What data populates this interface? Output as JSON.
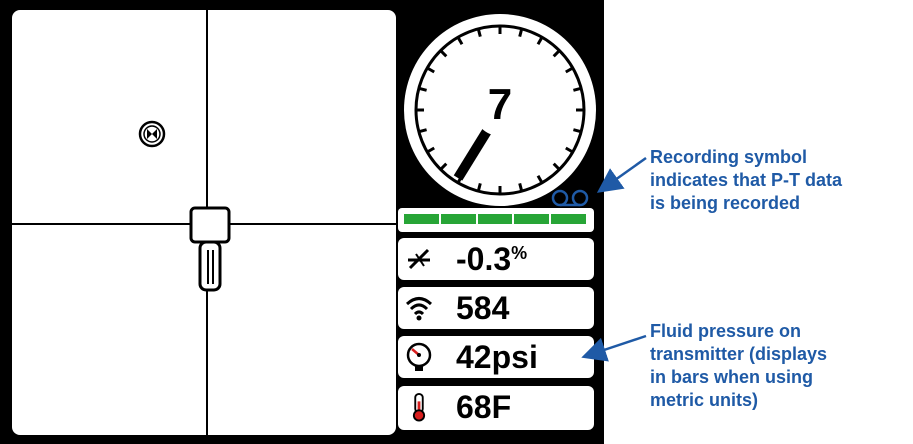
{
  "depth_dial": {
    "value": "7"
  },
  "signal_strength": {
    "level": 1.0,
    "segments": 5
  },
  "readouts": {
    "pitch": {
      "icon": "pitch-icon",
      "value": "-0.3",
      "unit": "%"
    },
    "signal": {
      "icon": "wifi-signal-icon",
      "value": "584"
    },
    "pressure": {
      "icon": "pressure-gauge-icon",
      "value": "42psi"
    },
    "temperature": {
      "icon": "thermometer-icon",
      "value": "68F"
    }
  },
  "annotations": {
    "recording": [
      "Recording symbol",
      "indicates that P-T data",
      "is being recorded"
    ],
    "pressure": [
      "Fluid pressure on",
      "transmitter (displays",
      "in bars when using",
      "metric units)"
    ]
  },
  "colors": {
    "device_frame": "#000000",
    "signal_green": "#27a536",
    "annotation_blue": "#1f5aa6",
    "recording_symbol": "#1f5aa6",
    "gauge_red": "#d81e1e"
  }
}
